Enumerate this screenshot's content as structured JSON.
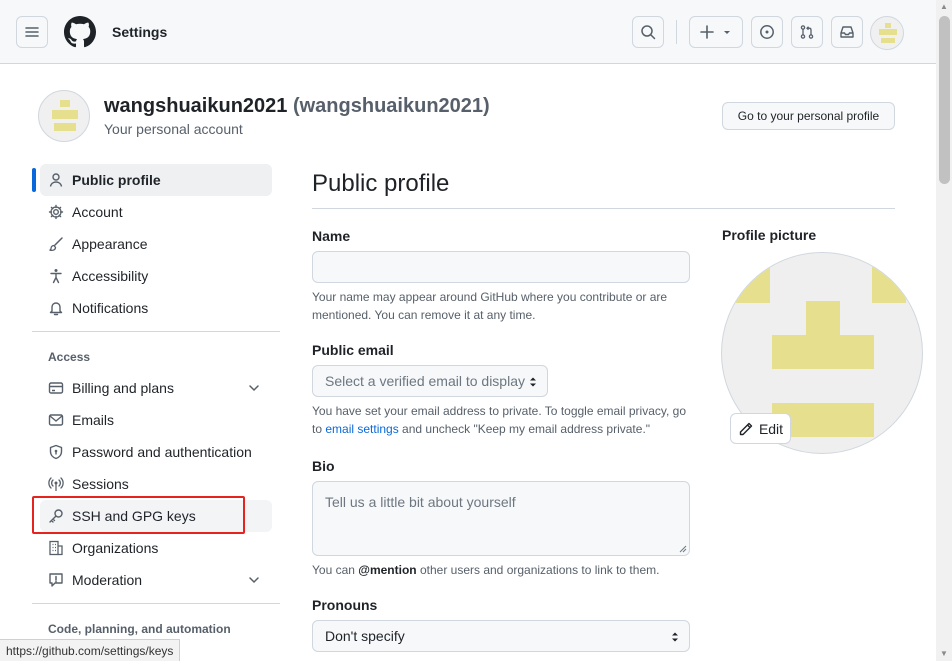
{
  "header": {
    "title": "Settings",
    "menu_icon": "hamburger-icon",
    "logo": "github-logo-icon",
    "search_icon": "search-icon",
    "create_icon": "plus-icon",
    "issues_icon": "issue-opened-icon",
    "pulls_icon": "git-pull-request-icon",
    "inbox_icon": "inbox-icon"
  },
  "account": {
    "name": "wangshuaikun2021",
    "login": "(wangshuaikun2021)",
    "subtitle": "Your personal account",
    "profile_button": "Go to your personal profile"
  },
  "sidebar": {
    "items": [
      {
        "label": "Public profile",
        "icon": "person-icon"
      },
      {
        "label": "Account",
        "icon": "gear-icon"
      },
      {
        "label": "Appearance",
        "icon": "paintbrush-icon"
      },
      {
        "label": "Accessibility",
        "icon": "accessibility-icon"
      },
      {
        "label": "Notifications",
        "icon": "bell-icon"
      }
    ],
    "access_heading": "Access",
    "access_items": [
      {
        "label": "Billing and plans",
        "icon": "credit-card-icon"
      },
      {
        "label": "Emails",
        "icon": "mail-icon"
      },
      {
        "label": "Password and authentication",
        "icon": "shield-lock-icon"
      },
      {
        "label": "Sessions",
        "icon": "broadcast-icon"
      },
      {
        "label": "SSH and GPG keys",
        "icon": "key-icon"
      },
      {
        "label": "Organizations",
        "icon": "organization-icon"
      },
      {
        "label": "Moderation",
        "icon": "report-icon"
      }
    ],
    "code_heading": "Code, planning, and automation"
  },
  "main": {
    "title": "Public profile",
    "name_label": "Name",
    "name_value": "",
    "name_note": "Your name may appear around GitHub where you contribute or are mentioned. You can remove it at any time.",
    "email_label": "Public email",
    "email_select": "Select a verified email to display",
    "email_note_1": "You have set your email address to private. To toggle email privacy, go to ",
    "email_note_link": "email settings",
    "email_note_2": " and uncheck \"Keep my email address private.\"",
    "bio_label": "Bio",
    "bio_placeholder": "Tell us a little bit about yourself",
    "bio_note_1": "You can ",
    "bio_note_mention": "@mention",
    "bio_note_2": " other users and organizations to link to them.",
    "pronouns_label": "Pronouns",
    "pronouns_value": "Don't specify"
  },
  "profile_picture": {
    "label": "Profile picture",
    "edit": "Edit"
  },
  "statusbar": {
    "url": "https://github.com/settings/keys"
  },
  "colors": {
    "accent": "#0969da",
    "highlight_box": "#e5231f",
    "identicon": "#e6e08e"
  }
}
